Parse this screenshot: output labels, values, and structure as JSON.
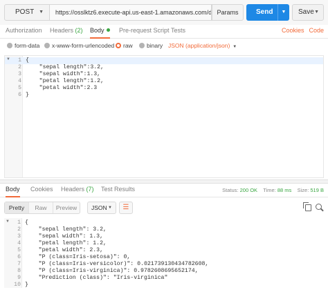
{
  "request": {
    "method": "POST",
    "url": "https://osslktz6.execute-api.us-east-1.amazonaws.com/demo/...",
    "params_label": "Params",
    "send_label": "Send",
    "save_label": "Save"
  },
  "request_tabs": {
    "authorization": "Authorization",
    "headers": "Headers",
    "headers_count": "(2)",
    "body": "Body",
    "prerequest": "Pre-request Script",
    "tests": "Tests",
    "cookies_link": "Cookies",
    "code_link": "Code"
  },
  "body_options": {
    "form_data": "form-data",
    "urlencoded": "x-www-form-urlencoded",
    "raw": "raw",
    "binary": "binary",
    "content_type": "JSON (application/json)"
  },
  "request_body": {
    "line_numbers": [
      "1",
      "2",
      "3",
      "4",
      "5",
      "6"
    ],
    "lines": [
      "{",
      "    \"sepal length\":3.2,",
      "    \"sepal width\":1.3,",
      "    \"petal length\":1.2,",
      "    \"petal width\":2.3",
      "}"
    ]
  },
  "response_tabs": {
    "body": "Body",
    "cookies": "Cookies",
    "headers": "Headers",
    "headers_count": "(7)",
    "test_results": "Test Results",
    "status_label": "Status:",
    "status_value": "200 OK",
    "time_label": "Time:",
    "time_value": "88 ms",
    "size_label": "Size:",
    "size_value": "519 B"
  },
  "response_tools": {
    "pretty": "Pretty",
    "raw": "Raw",
    "preview": "Preview",
    "format": "JSON",
    "wrap_icon": "wrap-lines-icon",
    "copy_icon": "copy-icon",
    "search_icon": "search-icon"
  },
  "response_body": {
    "line_numbers": [
      "1",
      "2",
      "3",
      "4",
      "5",
      "6",
      "7",
      "8",
      "9",
      "10"
    ],
    "lines": [
      "{",
      "    \"sepal length\": 3.2,",
      "    \"sepal width\": 1.3,",
      "    \"petal length\": 1.2,",
      "    \"petal width\": 2.3,",
      "    \"P (class=Iris-setosa)\": 0,",
      "    \"P (class=Iris-versicolor)\": 0.021739130434782608,",
      "    \"P (class=Iris-virginica)\": 0.9782608695652174,",
      "    \"Prediction (class)\": \"Iris-virginica\"",
      "}"
    ]
  },
  "colors": {
    "accent": "#f26b3a",
    "send_blue": "#1e88e5",
    "ok_green": "#3aa642"
  }
}
